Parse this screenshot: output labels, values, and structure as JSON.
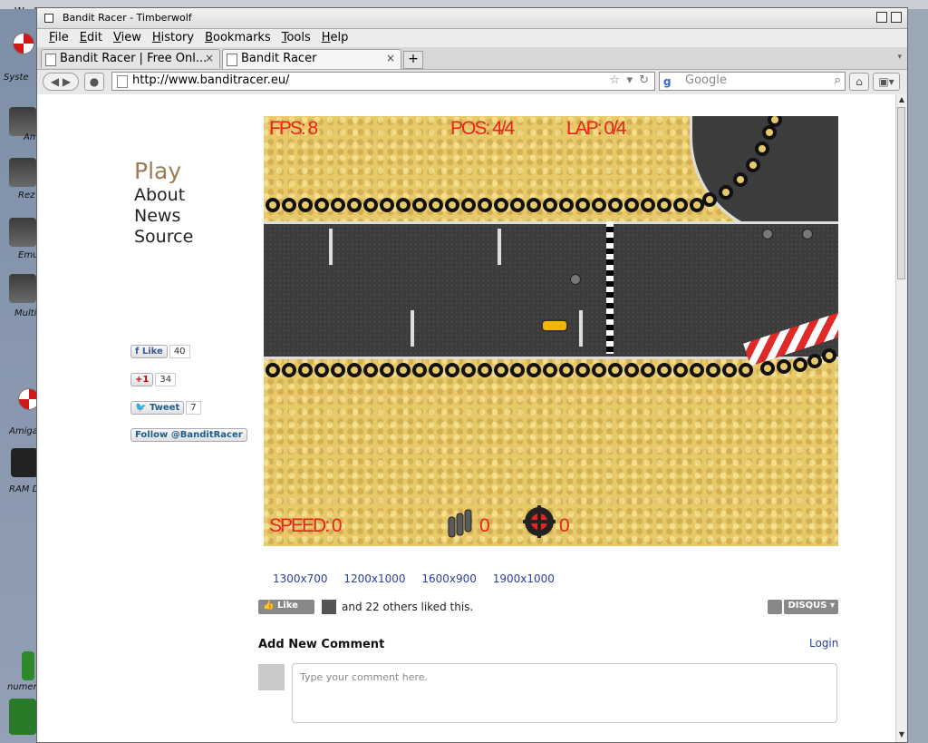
{
  "desktop": {
    "title": "Work",
    "icons": [
      {
        "label": "Syste"
      },
      {
        "label": "Am"
      },
      {
        "label": "Rez"
      },
      {
        "label": "Emu"
      },
      {
        "label": "Multi"
      },
      {
        "label": "Amiga"
      },
      {
        "label": "RAM D"
      },
      {
        "label": "numer"
      }
    ]
  },
  "window": {
    "title": "Bandit Racer - Timberwolf",
    "menu": [
      "File",
      "Edit",
      "View",
      "History",
      "Bookmarks",
      "Tools",
      "Help"
    ],
    "tabs": [
      {
        "label": "Bandit Racer | Free Onl...",
        "active": false
      },
      {
        "label": "Bandit Racer",
        "active": true
      }
    ],
    "new_tab": "+",
    "url": "http://www.banditracer.eu/",
    "search_placeholder": "Google",
    "search_engine_glyph": "g"
  },
  "site_nav": [
    "Play",
    "About",
    "News",
    "Source"
  ],
  "social": {
    "fb_like": "Like",
    "fb_count": "40",
    "gplus": "+1",
    "gplus_count": "34",
    "tweet": "Tweet",
    "tweet_count": "7",
    "follow": "Follow @BanditRacer"
  },
  "game_hud": {
    "fps": "FPS: 8",
    "pos": "POS: 4/4",
    "lap": "LAP: 0/4",
    "speed": "SPEED: 0",
    "bullets": "0",
    "mines": "0"
  },
  "resolutions": [
    "1300x700",
    "1200x1000",
    "1600x900",
    "1900x1000"
  ],
  "reactions": {
    "like_label": "Like",
    "liked_text": "and 22 others liked this.",
    "disqus_label": "DISQUS"
  },
  "comments": {
    "heading": "Add New Comment",
    "login": "Login",
    "placeholder": "Type your comment here."
  },
  "colors": {
    "hud_red": "#e8231d",
    "nav_play": "#9b7c55",
    "link_blue": "#2a3f9b"
  }
}
